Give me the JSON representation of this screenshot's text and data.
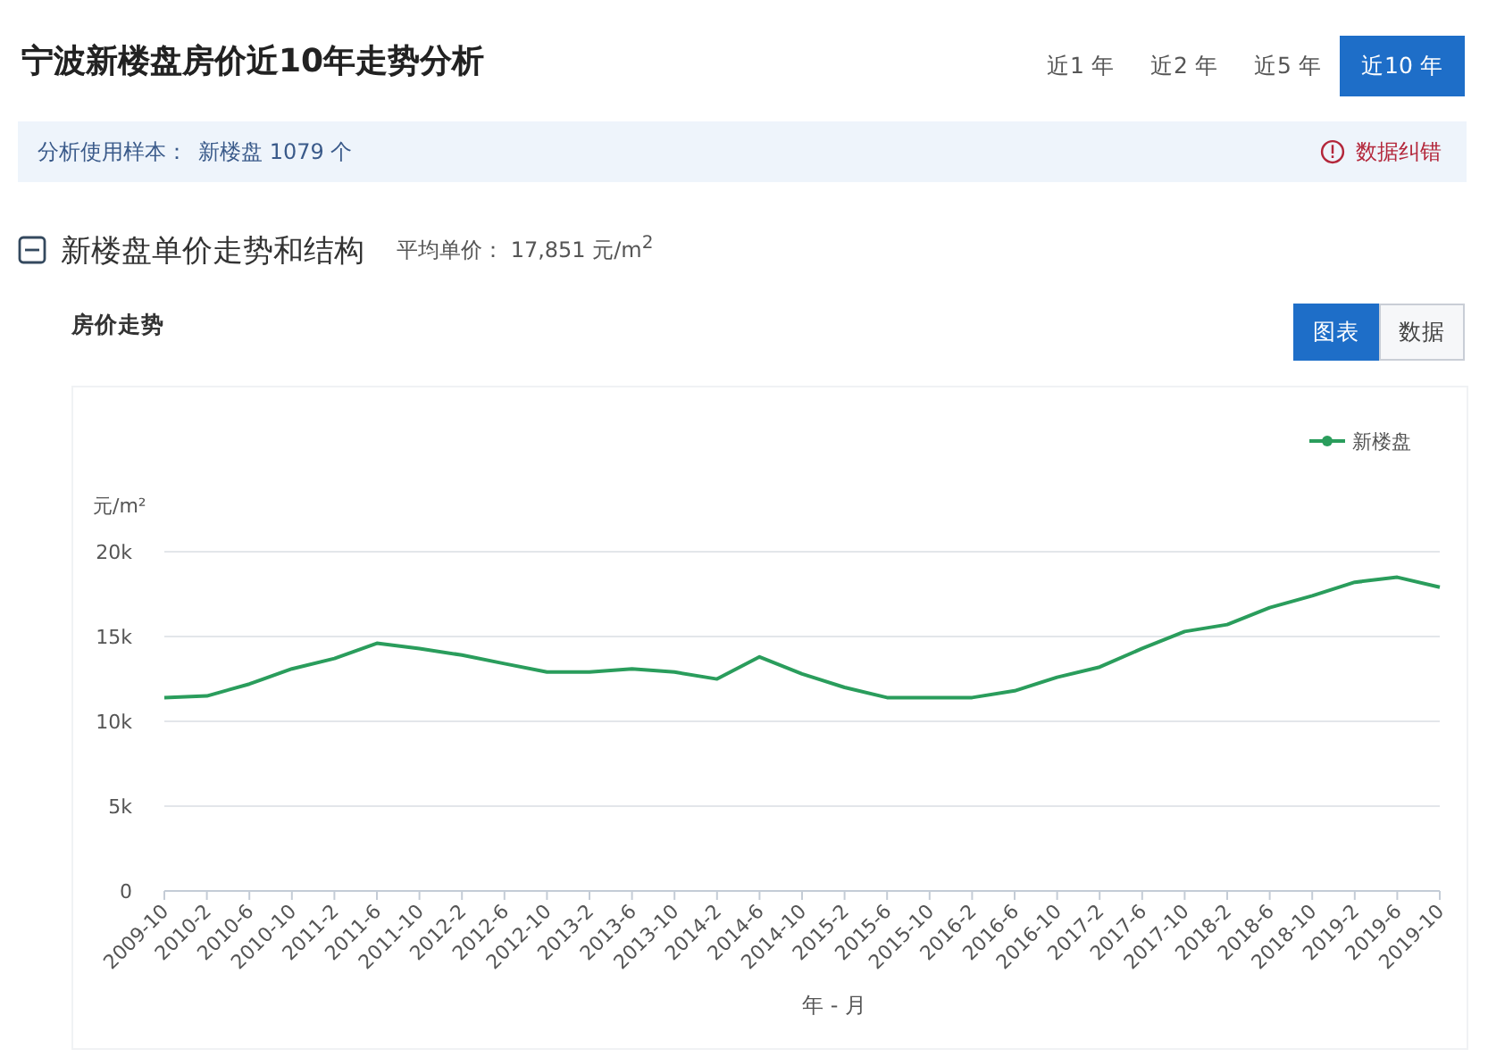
{
  "header": {
    "title": "宁波新楼盘房价近10年走势分析",
    "tabs": [
      {
        "label": "近1 年",
        "selected": false
      },
      {
        "label": "近2 年",
        "selected": false
      },
      {
        "label": "近5 年",
        "selected": false
      },
      {
        "label": "近10 年",
        "selected": true
      }
    ]
  },
  "info_bar": {
    "label": "分析使用样本：",
    "value": "新楼盘 1079 个",
    "report_link": "数据纠错"
  },
  "section": {
    "title": "新楼盘单价走势和结构",
    "average": "平均单价： 17,851 元/m$^{2}$",
    "expanded": true
  },
  "panel": {
    "title": "房价走势",
    "view_toggle": [
      {
        "label": "图表",
        "selected": true
      },
      {
        "label": "数据",
        "selected": false
      }
    ],
    "chart_data": {
      "type": "line",
      "xlabel": "年 - 月",
      "ylabel": "元/m²",
      "categories": [
        "2009-10",
        "2010-2",
        "2010-6",
        "2010-10",
        "2011-2",
        "2011-6",
        "2011-10",
        "2012-2",
        "2012-6",
        "2012-10",
        "2013-2",
        "2013-6",
        "2013-10",
        "2014-2",
        "2014-6",
        "2014-10",
        "2015-2",
        "2015-6",
        "2015-10",
        "2016-2",
        "2016-6",
        "2016-10",
        "2017-2",
        "2017-6",
        "2017-10",
        "2018-2",
        "2018-6",
        "2018-10",
        "2019-2",
        "2019-6",
        "2019-10"
      ],
      "series": [
        {
          "name": "新楼盘",
          "color": "#2a9d5c",
          "values": [
            11400,
            11500,
            12200,
            13100,
            13700,
            14600,
            14300,
            13900,
            13400,
            12900,
            12900,
            13100,
            12900,
            12500,
            13800,
            12800,
            12000,
            11400,
            11400,
            11400,
            11800,
            12600,
            13200,
            14300,
            15300,
            15700,
            16700,
            17400,
            18200,
            18500,
            17900
          ]
        }
      ],
      "ylim": [
        0,
        20000
      ],
      "grid": true,
      "yticks": [
        {
          "value": 0,
          "label": "0"
        },
        {
          "value": 5000,
          "label": "5k"
        },
        {
          "value": 10000,
          "label": "10k"
        },
        {
          "value": 15000,
          "label": "15k"
        },
        {
          "value": 20000,
          "label": "20k"
        }
      ]
    }
  }
}
